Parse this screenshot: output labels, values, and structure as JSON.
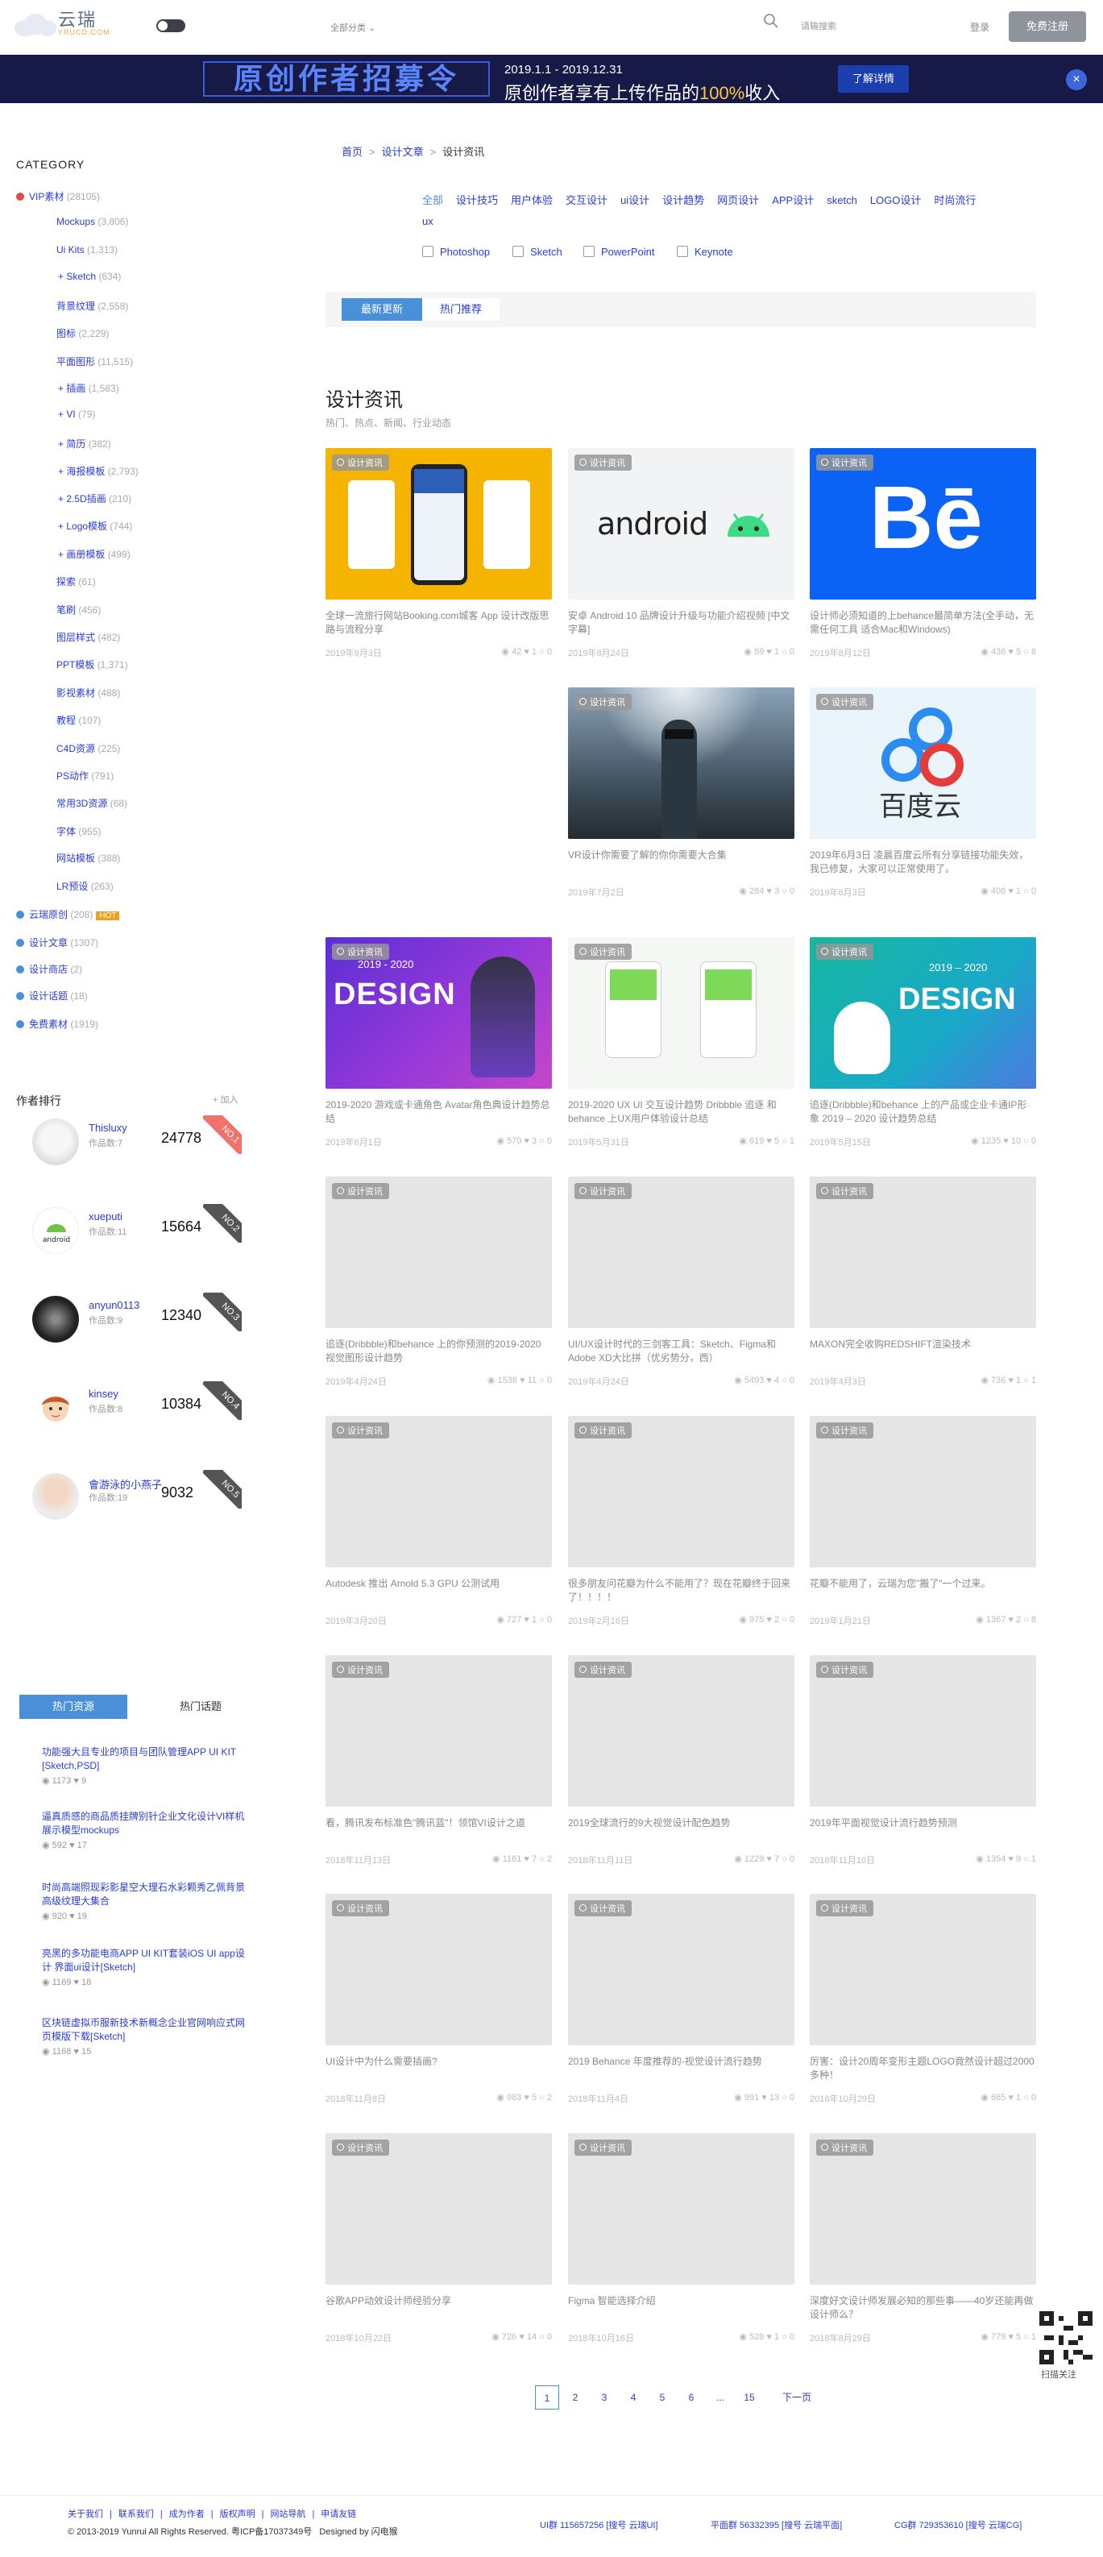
{
  "header": {
    "logo_cn": "云瑞",
    "logo_en": "YRUCD.COM",
    "category_dropdown": "全部分类",
    "search_placeholder": "请输搜索",
    "login": "登录",
    "register": "免费注册"
  },
  "banner": {
    "left_text": "原创作者招募令",
    "dates": "2019.1.1 - 2019.12.31",
    "text_pre": "原创作者享有上传作品的",
    "text_pct": "100%",
    "text_post": "收入",
    "button": "了解详情"
  },
  "sidebar": {
    "category_title": "CATEGORY",
    "categories": [
      {
        "label": "VIP素材",
        "count": "(28105)",
        "dot": "#e24a4a"
      },
      {
        "label": "Mockups",
        "count": "(3,806)"
      },
      {
        "label": "Ui Kits",
        "count": "(1,313)"
      },
      {
        "label": "+ Sketch",
        "count": "(634)"
      },
      {
        "label": "背景纹理",
        "count": "(2,558)"
      },
      {
        "label": "图标",
        "count": "(2,229)"
      },
      {
        "label": "平面图形",
        "count": "(11,515)"
      },
      {
        "label": "+ 插画",
        "count": "(1,583)"
      },
      {
        "label": "+ VI",
        "count": "(79)"
      },
      {
        "label": "+ 简历",
        "count": "(382)"
      },
      {
        "label": "+ 海报模板",
        "count": "(2,793)"
      },
      {
        "label": "+ 2.5D插画",
        "count": "(210)"
      },
      {
        "label": "+ Logo模板",
        "count": "(744)"
      },
      {
        "label": "+ 画册模板",
        "count": "(499)"
      },
      {
        "label": "探索",
        "count": "(61)"
      },
      {
        "label": "笔刷",
        "count": "(456)"
      },
      {
        "label": "图层样式",
        "count": "(482)"
      },
      {
        "label": "PPT模板",
        "count": "(1,371)"
      },
      {
        "label": "影视素材",
        "count": "(488)"
      },
      {
        "label": "教程",
        "count": "(107)"
      },
      {
        "label": "C4D资源",
        "count": "(225)"
      },
      {
        "label": "PS动作",
        "count": "(791)"
      },
      {
        "label": "常用3D资源",
        "count": "(68)"
      },
      {
        "label": "字体",
        "count": "(955)"
      },
      {
        "label": "网站模板",
        "count": "(388)"
      },
      {
        "label": "LR预设",
        "count": "(263)"
      },
      {
        "label": "云瑞原创",
        "count": "(208)",
        "dot": "#4a90d9",
        "hot": "HOT"
      },
      {
        "label": "设计文章",
        "count": "(1307)",
        "dot": "#4a90d9"
      },
      {
        "label": "设计商店",
        "count": "(2)",
        "dot": "#4a90d9"
      },
      {
        "label": "设计话题",
        "count": "(18)",
        "dot": "#4a90d9"
      },
      {
        "label": "免费素材",
        "count": "(1919)",
        "dot": "#4a90d9"
      }
    ],
    "author_title": "作者排行",
    "author_add": "+ 加入",
    "authors": [
      {
        "name": "Thisluxy",
        "works": "作品数:7",
        "score": "24778",
        "rank": "NO.1",
        "rank_color": "#f0736a"
      },
      {
        "name": "xueputi",
        "works": "作品数:11",
        "score": "15664",
        "rank": "NO.2",
        "rank_color": "#555"
      },
      {
        "name": "anyun0113",
        "works": "作品数:9",
        "score": "12340",
        "rank": "NO.3",
        "rank_color": "#555"
      },
      {
        "name": "kinsey",
        "works": "作品数:8",
        "score": "10384",
        "rank": "NO.4",
        "rank_color": "#555"
      },
      {
        "name": "會游泳的小燕子",
        "works": "作品数:19",
        "score": "9032",
        "rank": "NO.5",
        "rank_color": "#555"
      }
    ],
    "res_tab_active": "热门资源",
    "res_tab_other": "热门话题",
    "hot_resources": [
      {
        "title": "功能强大且专业的项目与团队管理APP UI KIT [Sketch,PSD]",
        "views": "1173",
        "likes": "9"
      },
      {
        "title": "逼真质感的商品质挂牌别针企业文化设计VI样机展示模型mockups",
        "views": "592",
        "likes": "17"
      },
      {
        "title": "时尚高端照现彩影星空大理石水彩颗秀乙佩背景高级纹理大集合",
        "views": "920",
        "likes": "19"
      },
      {
        "title": "亮黑的多功能电商APP UI KIT套装iOS UI app设计 界面ui设计[Sketch]",
        "views": "1169",
        "likes": "18"
      },
      {
        "title": "区块链虚拟币服新技术新概念企业官网响应式网页模版下载[Sketch]",
        "views": "1168",
        "likes": "15"
      }
    ]
  },
  "breadcrumb": {
    "home": "首页",
    "level1": "设计文章",
    "current": "设计资讯"
  },
  "tags": [
    "全部",
    "设计技巧",
    "用户体验",
    "交互设计",
    "ui设计",
    "设计趋势",
    "网页设计",
    "APP设计",
    "sketch",
    "LOGO设计",
    "时尚流行",
    "ux"
  ],
  "checkboxes": [
    "Photoshop",
    "Sketch",
    "PowerPoint",
    "Keynote"
  ],
  "sort": {
    "latest": "最新更新",
    "popular": "热门推荐"
  },
  "page_title": "设计资讯",
  "page_subtitle": "热门、热点、新闻、行业动态",
  "tag_label": "设计资讯",
  "posts": [
    {
      "title": "全球一流旅行网站Booking.com城客 App 设计改版思路与流程分享",
      "date": "2019年9月3日",
      "views": "42",
      "likes": "1",
      "comments": "0",
      "img": "booking"
    },
    {
      "title": "安卓 Android 10 品牌设计升级与功能介绍视频 [中文字幕]",
      "date": "2019年8月24日",
      "views": "59",
      "likes": "1",
      "comments": "0",
      "img": "android"
    },
    {
      "title": "设计师必须知道的上behance最简单方法(全手动，无需任何工具 适合Mac和Windows)",
      "date": "2019年8月12日",
      "views": "436",
      "likes": "5",
      "comments": "8",
      "img": "behance"
    },
    {
      "title": "",
      "date": "",
      "views": "",
      "likes": "",
      "comments": "",
      "img": "none"
    },
    {
      "title": "VR设计你需要了解的你你需要大合集",
      "date": "2019年7月2日",
      "views": "284",
      "likes": "3",
      "comments": "0",
      "img": "vr"
    },
    {
      "title": "2019年6月3日 凌晨百度云所有分享链接功能失效，我已修复，大家可以正常使用了。",
      "date": "2019年6月3日",
      "views": "408",
      "likes": "1",
      "comments": "0",
      "img": "baidu"
    },
    {
      "title": "2019-2020 游戏或卡通角色 Avatar角色典设计趋势总结",
      "date": "2019年6月1日",
      "views": "570",
      "likes": "3",
      "comments": "0",
      "img": "design1"
    },
    {
      "title": "2019-2020 UX UI 交互设计趋势 Dribbble 追逐 和 behance 上UX用户体验设计总结",
      "date": "2019年5月31日",
      "views": "619",
      "likes": "5",
      "comments": "1",
      "img": "ux"
    },
    {
      "title": "追逐(Dribbble)和behance 上的产品或企业卡通IP形象 2019 – 2020 设计趋势总结",
      "date": "2019年5月15日",
      "views": "1235",
      "likes": "10",
      "comments": "0",
      "img": "design2"
    },
    {
      "title": "追逐(Dribbble)和behance 上的你预测的2019-2020 视觉图形设计趋势",
      "date": "2019年4月24日",
      "views": "1536",
      "likes": "11",
      "comments": "0",
      "img": "gray"
    },
    {
      "title": "UI/UX设计时代的三剑客工具：Sketch、Figma和Adobe XD大比拼（优劣势分，西）",
      "date": "2019年4月24日",
      "views": "5493",
      "likes": "4",
      "comments": "0",
      "img": "gray"
    },
    {
      "title": "MAXON完全收购REDSHIFT渲染技术",
      "date": "2019年4月3日",
      "views": "736",
      "likes": "1",
      "comments": "1",
      "img": "gray"
    },
    {
      "title": "Autodesk 推出 Arnold 5.3 GPU 公测试用",
      "date": "2019年3月20日",
      "views": "727",
      "likes": "1",
      "comments": "0",
      "img": "gray"
    },
    {
      "title": "很多朋友问花瓣为什么不能用了？现在花瓣终于回来了！！！！",
      "date": "2019年2月16日",
      "views": "975",
      "likes": "2",
      "comments": "0",
      "img": "gray"
    },
    {
      "title": "花瓣不能用了，云瑞为您\"搬了\"一个过来。",
      "date": "2019年1月21日",
      "views": "1367",
      "likes": "2",
      "comments": "8",
      "img": "gray"
    },
    {
      "title": "看，腾讯发布标准色\"腾讯蓝\"！领馆VI设计之道",
      "date": "2018年11月13日",
      "views": "1161",
      "likes": "7",
      "comments": "2",
      "img": "gray"
    },
    {
      "title": "2019全球流行的9大视觉设计配色趋势",
      "date": "2018年11月11日",
      "views": "1229",
      "likes": "7",
      "comments": "0",
      "img": "gray"
    },
    {
      "title": "2019年平面视觉设计流行趋势预测",
      "date": "2018年11月10日",
      "views": "1354",
      "likes": "9",
      "comments": "1",
      "img": "gray"
    },
    {
      "title": "UI设计中为什么需要插画?",
      "date": "2018年11月8日",
      "views": "983",
      "likes": "5",
      "comments": "2",
      "img": "gray"
    },
    {
      "title": "2019 Behance 年度推荐的-视觉设计流行趋势",
      "date": "2018年11月4日",
      "views": "991",
      "likes": "13",
      "comments": "0",
      "img": "gray"
    },
    {
      "title": "厉害：设计20周年变形主题LOGO竟然设计超过2000多种！",
      "date": "2018年10月29日",
      "views": "665",
      "likes": "1",
      "comments": "0",
      "img": "gray"
    },
    {
      "title": "谷歌APP动效设计师经验分享",
      "date": "2018年10月22日",
      "views": "726",
      "likes": "14",
      "comments": "0",
      "img": "gray"
    },
    {
      "title": "Figma 智能选择介绍",
      "date": "2018年10月16日",
      "views": "528",
      "likes": "1",
      "comments": "0",
      "img": "gray"
    },
    {
      "title": "深度好文设计师发展必知的那些事——40岁还能再做设计师么？",
      "date": "2018年8月29日",
      "views": "779",
      "likes": "5",
      "comments": "1",
      "img": "gray"
    }
  ],
  "pagination": [
    "1",
    "2",
    "3",
    "4",
    "5",
    "6",
    "...",
    "15",
    "下一页"
  ],
  "qr_label": "扫描关注",
  "footer": {
    "links": [
      "关于我们",
      "|",
      "联系我们",
      "|",
      "成为作者",
      "|",
      "版权声明",
      "|",
      "网站导航",
      "|",
      "申请友链"
    ],
    "copyright": "© 2013-2019 Yunrui All Rights Reserved. 粤ICP备17037349号",
    "designer": "Designed by 闪电猴",
    "group1": "UI群 115657256 [搜号 云瑞UI]",
    "group2": "平面群 56332395 [搜号 云瑞平面]",
    "group3": "CG群 729353610 [搜号 云瑞CG]"
  }
}
